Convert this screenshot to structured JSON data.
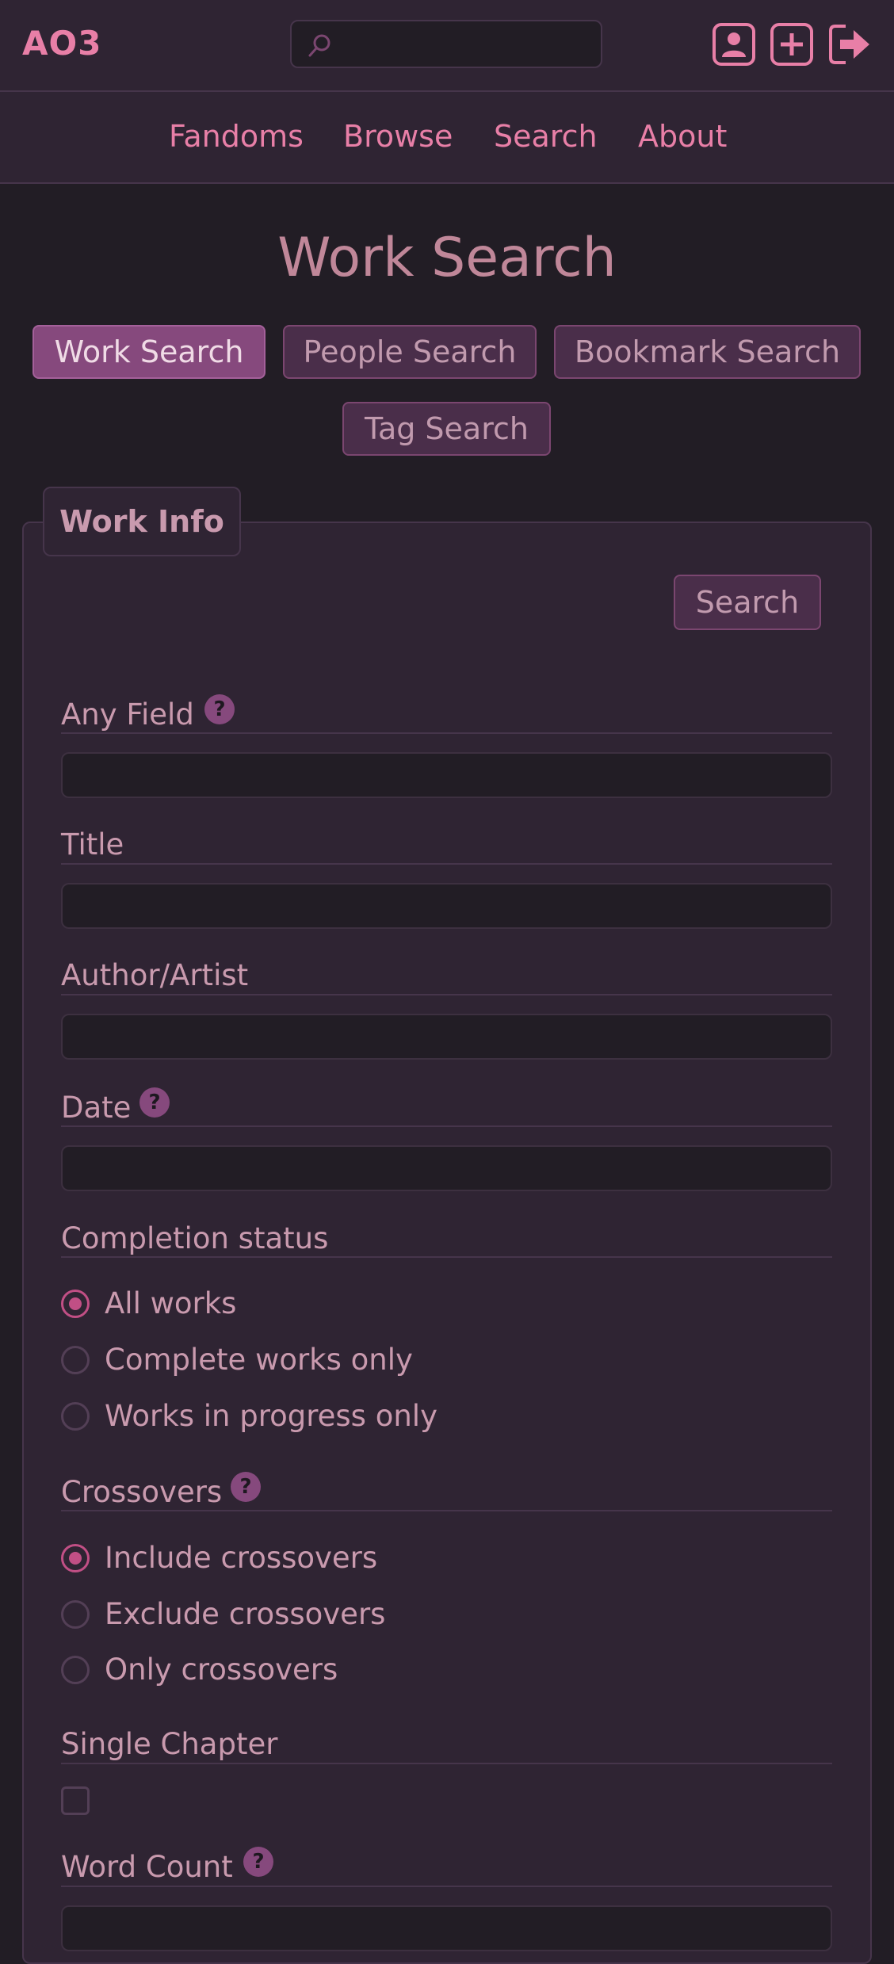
{
  "header": {
    "logo": "AO3",
    "search_placeholder": "",
    "icons": [
      "user-profile-icon",
      "plus-square-icon",
      "sign-out-icon"
    ]
  },
  "nav": {
    "items": [
      "Fandoms",
      "Browse",
      "Search",
      "About"
    ]
  },
  "page": {
    "title": "Work Search",
    "tabs": [
      "Work Search",
      "People Search",
      "Bookmark Search",
      "Tag Search"
    ],
    "active_tab": "Work Search"
  },
  "form": {
    "legend": "Work Info",
    "search_button": "Search",
    "fields": {
      "any_field": {
        "label": "Any Field",
        "value": "",
        "help": "?"
      },
      "title": {
        "label": "Title",
        "value": ""
      },
      "author": {
        "label": "Author/Artist",
        "value": ""
      },
      "date": {
        "label": "Date",
        "value": "",
        "help": "?"
      },
      "word_count": {
        "label": "Word Count",
        "value": "",
        "help": "?"
      }
    },
    "completion": {
      "label": "Completion status",
      "options": [
        "All works",
        "Complete works only",
        "Works in progress only"
      ],
      "selected": "All works"
    },
    "crossovers": {
      "label": "Crossovers",
      "help": "?",
      "options": [
        "Include crossovers",
        "Exclude crossovers",
        "Only crossovers"
      ],
      "selected": "Include crossovers"
    },
    "single_chapter": {
      "label": "Single Chapter",
      "checked": false
    }
  },
  "colors": {
    "background": "#221d25",
    "panel": "#2f2433",
    "accent": "#e87fa7",
    "active_tab": "#86497d",
    "radio_checked": "#c14f85"
  }
}
